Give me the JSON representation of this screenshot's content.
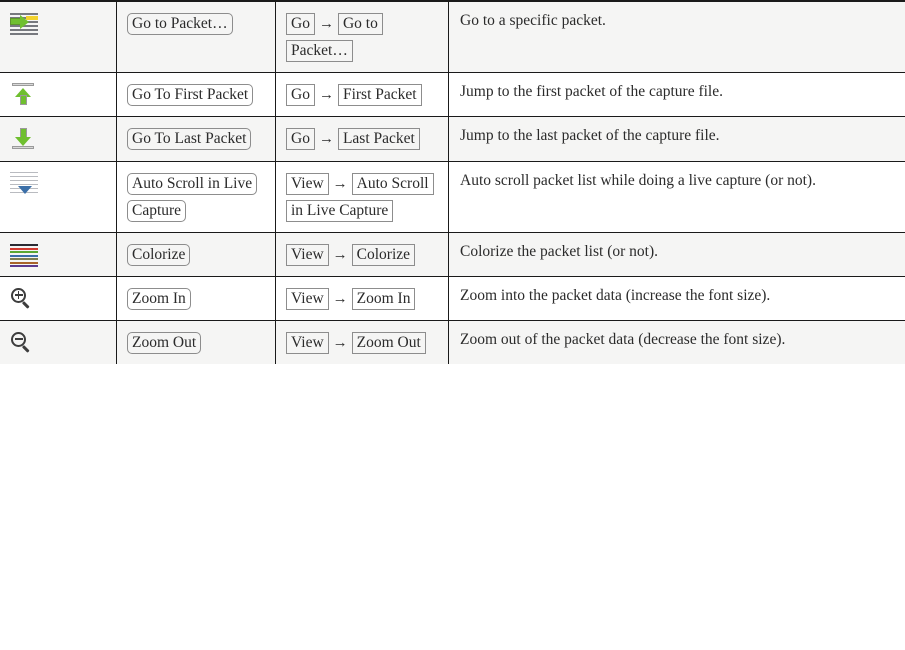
{
  "table": {
    "rows": [
      {
        "icon": "go-to-packet-icon",
        "button": {
          "parts": [
            {
              "type": "chip",
              "text": "Go to Packet…"
            }
          ]
        },
        "button_label": "Go to Packet…",
        "menu": {
          "parts": [
            {
              "type": "chip",
              "text": "Go"
            },
            {
              "type": "arrow",
              "text": "→"
            },
            {
              "type": "chip",
              "text": "Go to Packet…"
            }
          ]
        },
        "menu_path": "Go → Go to Packet…",
        "description": "Go to a specific packet."
      },
      {
        "icon": "go-to-first-packet-icon",
        "button": {
          "parts": [
            {
              "type": "chip",
              "text": "Go To First Packet"
            }
          ]
        },
        "button_label": "Go To First Packet",
        "menu": {
          "parts": [
            {
              "type": "chip",
              "text": "Go"
            },
            {
              "type": "arrow",
              "text": "→"
            },
            {
              "type": "chip",
              "text": "First Packet"
            }
          ]
        },
        "menu_path": "Go → First Packet",
        "description": "Jump to the first packet of the capture file."
      },
      {
        "icon": "go-to-last-packet-icon",
        "button": {
          "parts": [
            {
              "type": "chip",
              "text": "Go To Last Packet"
            }
          ]
        },
        "button_label": "Go To Last Packet",
        "menu": {
          "parts": [
            {
              "type": "chip",
              "text": "Go"
            },
            {
              "type": "arrow",
              "text": "→"
            },
            {
              "type": "chip",
              "text": "Last Packet"
            }
          ]
        },
        "menu_path": "Go → Last Packet",
        "description": "Jump to the last packet of the capture file."
      },
      {
        "icon": "auto-scroll-icon",
        "button": {
          "parts": [
            {
              "type": "chip",
              "text": "Auto Scroll in Live Capture"
            }
          ]
        },
        "button_label": "Auto Scroll in Live Capture",
        "menu": {
          "parts": [
            {
              "type": "chip",
              "text": "View"
            },
            {
              "type": "arrow",
              "text": "→"
            },
            {
              "type": "chip",
              "text": "Auto Scroll in Live Capture"
            }
          ]
        },
        "menu_path": "View → Auto Scroll in Live Capture",
        "description": "Auto scroll packet list while doing a live capture (or not)."
      },
      {
        "icon": "colorize-icon",
        "button": {
          "parts": [
            {
              "type": "chip",
              "text": "Colorize"
            }
          ]
        },
        "button_label": "Colorize",
        "menu": {
          "parts": [
            {
              "type": "chip",
              "text": "View"
            },
            {
              "type": "arrow",
              "text": "→"
            },
            {
              "type": "chip",
              "text": "Colorize"
            }
          ]
        },
        "menu_path": "View → Colorize",
        "description": "Colorize the packet list (or not)."
      },
      {
        "icon": "zoom-in-icon",
        "button": {
          "parts": [
            {
              "type": "chip",
              "text": "Zoom In"
            }
          ]
        },
        "button_label": "Zoom In",
        "menu": {
          "parts": [
            {
              "type": "chip",
              "text": "View"
            },
            {
              "type": "arrow",
              "text": "→"
            },
            {
              "type": "chip",
              "text": "Zoom In"
            }
          ]
        },
        "menu_path": "View → Zoom In",
        "description": "Zoom into the packet data (increase the font size)."
      },
      {
        "icon": "zoom-out-icon",
        "button": {
          "parts": [
            {
              "type": "chip",
              "text": "Zoom Out"
            }
          ]
        },
        "button_label": "Zoom Out",
        "menu": {
          "parts": [
            {
              "type": "chip",
              "text": "View"
            },
            {
              "type": "arrow",
              "text": "→"
            },
            {
              "type": "chip",
              "text": "Zoom Out"
            }
          ]
        },
        "menu_path": "View → Zoom Out",
        "description": "Zoom out of the packet data (decrease the font size)."
      }
    ]
  },
  "colors": {
    "arrow_green": "#6fbf2f",
    "highlight_yellow": "#f2d22e",
    "scroll_blue": "#3b6fa8",
    "line_gray": "#6f7176",
    "border": "#1a1a1a",
    "row_alt_bg": "#f5f5f4",
    "row_bg": "#ffffff",
    "colorize_stripes": [
      "#2b2b33",
      "#d0392f",
      "#5aa832",
      "#3b6fa8",
      "#7d7d50",
      "#a8642a",
      "#5b3a8e"
    ]
  }
}
